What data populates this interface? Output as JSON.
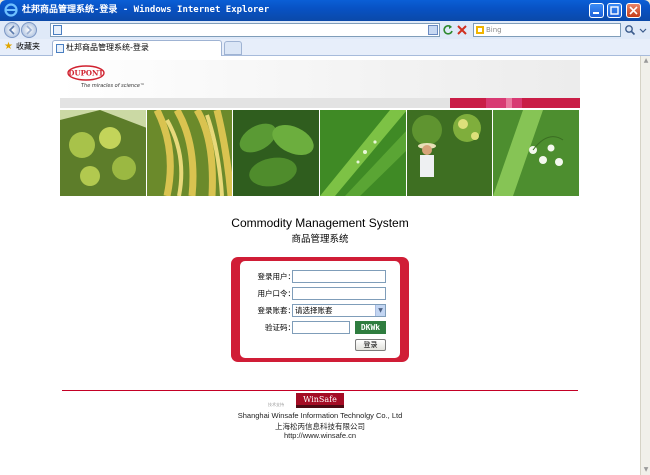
{
  "window": {
    "title": "杜邦商品管理系统-登录 - Windows Internet Explorer"
  },
  "toolbar": {
    "address_value": "",
    "search_placeholder": "Bing",
    "favorites_label": "收藏夹",
    "tab_title": "杜邦商品管理系统-登录"
  },
  "header": {
    "logo_text": "DUPONT",
    "tagline": "The miracles of science™",
    "brand_red": "#c91d46",
    "photos": [
      {
        "subject": "chestnuts",
        "color": "#8fae3c"
      },
      {
        "subject": "rice-ears",
        "color": "#b9a23a"
      },
      {
        "subject": "soy-leaves",
        "color": "#3f7d2a"
      },
      {
        "subject": "water-drop-grass",
        "color": "#5fae3a"
      },
      {
        "subject": "farmer-orchard",
        "color": "#4d8a2a"
      },
      {
        "subject": "lily-of-the-valley",
        "color": "#6cab55"
      }
    ]
  },
  "main": {
    "title_en": "Commodity Management System",
    "title_cn": "商品管理系统",
    "login": {
      "user_label": "登录用户：",
      "password_label": "用户口令：",
      "account_label": "登录账套：",
      "account_selected": "请选择账套",
      "captcha_label": "验证码：",
      "captcha_text": "DKWk",
      "login_button": "登录"
    }
  },
  "footer": {
    "powered_label": "技术支持",
    "winsafe_logo": "WinSafe",
    "company_en": "Shanghai Winsafe Information Technolgy Co., Ltd",
    "company_cn": "上海松丙信息科技有限公司",
    "url": "http://www.winsafe.cn"
  }
}
